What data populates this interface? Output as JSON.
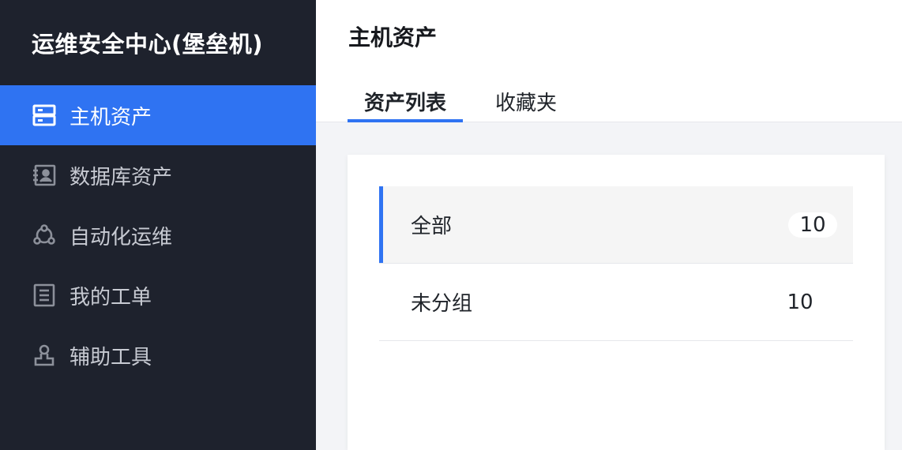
{
  "app": {
    "title": "运维安全中心(堡垒机)"
  },
  "sidebar": {
    "items": [
      {
        "label": "主机资产",
        "icon": "server-icon",
        "active": true
      },
      {
        "label": "数据库资产",
        "icon": "database-icon",
        "active": false
      },
      {
        "label": "自动化运维",
        "icon": "automation-icon",
        "active": false
      },
      {
        "label": "我的工单",
        "icon": "ticket-icon",
        "active": false
      },
      {
        "label": "辅助工具",
        "icon": "tool-icon",
        "active": false
      }
    ]
  },
  "header": {
    "title": "主机资产",
    "tabs": [
      {
        "label": "资产列表",
        "active": true
      },
      {
        "label": "收藏夹",
        "active": false
      }
    ]
  },
  "groups": [
    {
      "name": "全部",
      "count": "10",
      "active": true
    },
    {
      "name": "未分组",
      "count": "10",
      "active": false
    }
  ],
  "colors": {
    "sidebar_bg": "#1e222d",
    "accent": "#2f73f2",
    "page_bg": "#f3f4f7"
  }
}
